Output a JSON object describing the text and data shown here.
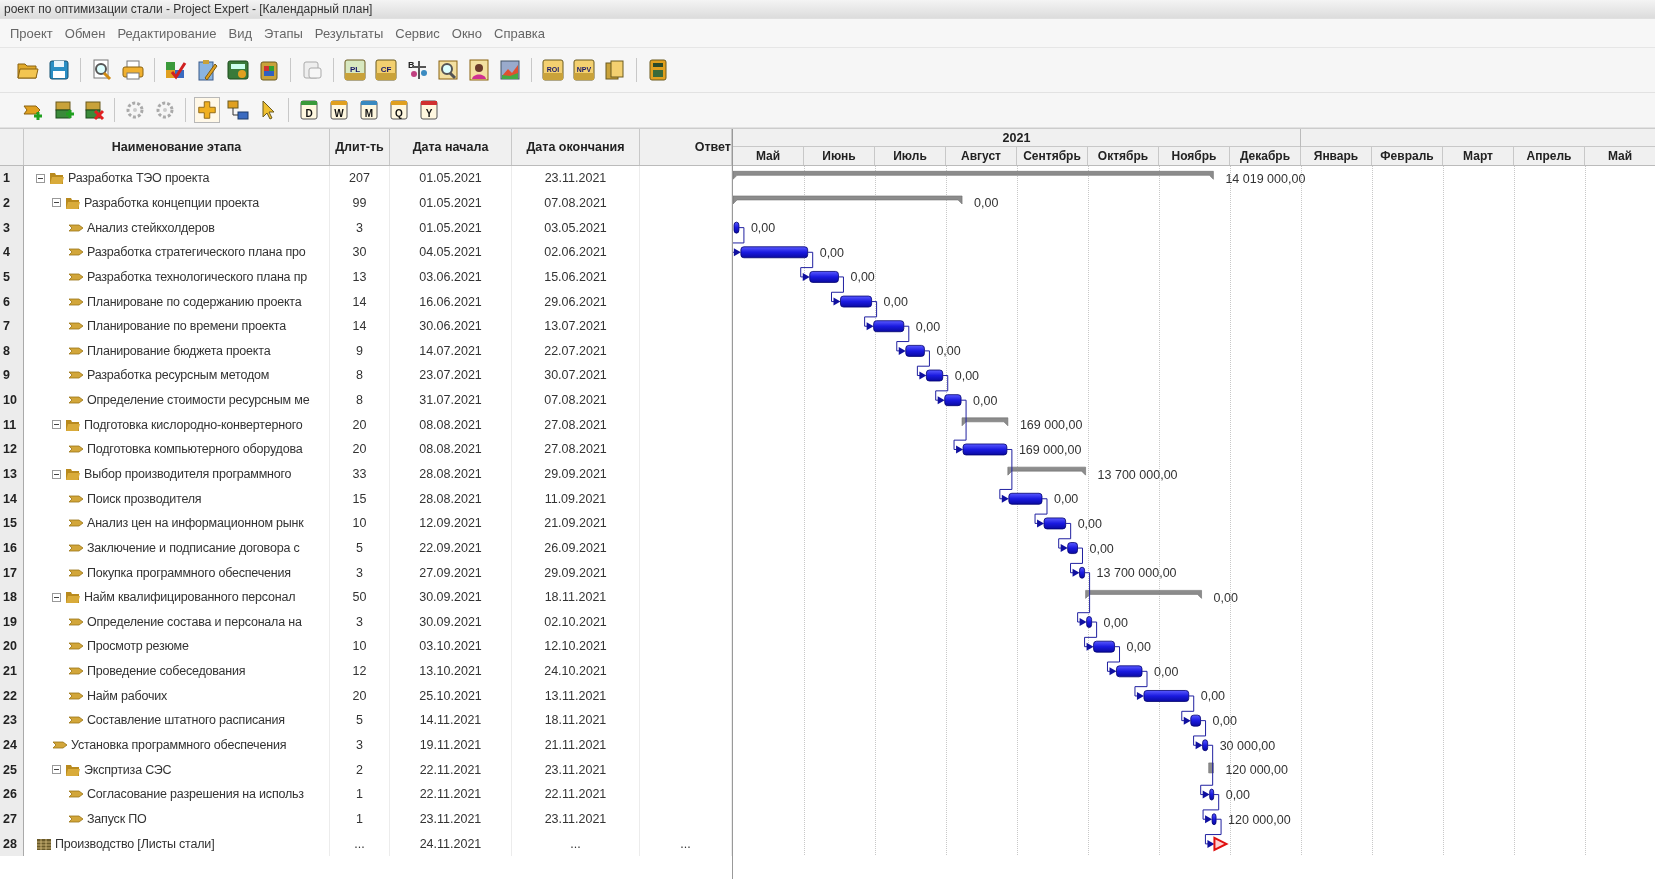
{
  "window": {
    "title": "роект по оптимизации стали - Project Expert  - [Календарный план]"
  },
  "menu": [
    "Проект",
    "Обмен",
    "Редактирование",
    "Вид",
    "Этапы",
    "Результаты",
    "Сервис",
    "Окно",
    "Справка"
  ],
  "toolbar_1": {
    "badges": [
      "PL",
      "CF",
      "B",
      "ROI",
      "NPV"
    ]
  },
  "toolbar_2": {
    "badges": [
      "D",
      "W",
      "M",
      "Q",
      "Y"
    ]
  },
  "table": {
    "columns": [
      "Наименование этапа",
      "Длит-ть",
      "Дата начала",
      "Дата окончания",
      "Ответ"
    ]
  },
  "timeline": {
    "groups": [
      {
        "year": "2021",
        "months": [
          "Май",
          "Июнь",
          "Июль",
          "Август",
          "Сентябрь",
          "Октябрь",
          "Ноябрь",
          "Декабрь"
        ]
      },
      {
        "months": [
          "Январь",
          "Февраль",
          "Март",
          "Апрель",
          "Май"
        ]
      }
    ]
  },
  "rows": [
    {
      "num": "1",
      "kind": "summary",
      "expanded": true,
      "name": "Разработка ТЭО проекта",
      "duration": "207",
      "start": "01.05.2021",
      "end": "23.11.2021",
      "cost": "14 019 000,00",
      "children": [
        {
          "num": "2",
          "kind": "summary",
          "expanded": true,
          "name": "Разработка концепции проекта",
          "duration": "99",
          "start": "01.05.2021",
          "end": "07.08.2021",
          "cost": "0,00",
          "children": [
            {
              "num": "3",
              "kind": "task",
              "name": "Анализ стейкхолдеров",
              "duration": "3",
              "start": "01.05.2021",
              "end": "03.05.2021",
              "cost": "0,00"
            },
            {
              "num": "4",
              "kind": "task",
              "name": "Разработка стратегического плана про",
              "duration": "30",
              "start": "04.05.2021",
              "end": "02.06.2021",
              "cost": "0,00"
            },
            {
              "num": "5",
              "kind": "task",
              "name": "Разработка технологического плана пр",
              "duration": "13",
              "start": "03.06.2021",
              "end": "15.06.2021",
              "cost": "0,00"
            },
            {
              "num": "6",
              "kind": "task",
              "name": "Планироване по содержанию проекта",
              "duration": "14",
              "start": "16.06.2021",
              "end": "29.06.2021",
              "cost": "0,00"
            },
            {
              "num": "7",
              "kind": "task",
              "name": "Планирование по времени проекта",
              "duration": "14",
              "start": "30.06.2021",
              "end": "13.07.2021",
              "cost": "0,00"
            },
            {
              "num": "8",
              "kind": "task",
              "name": "Планирование бюджета проекта",
              "duration": "9",
              "start": "14.07.2021",
              "end": "22.07.2021",
              "cost": "0,00"
            },
            {
              "num": "9",
              "kind": "task",
              "name": "Разработка ресурсным методом",
              "duration": "8",
              "start": "23.07.2021",
              "end": "30.07.2021",
              "cost": "0,00"
            },
            {
              "num": "10",
              "kind": "task",
              "name": "Определение стоимости ресурсным ме",
              "duration": "8",
              "start": "31.07.2021",
              "end": "07.08.2021",
              "cost": "0,00"
            }
          ]
        },
        {
          "num": "11",
          "kind": "summary",
          "expanded": true,
          "name": "Подготовка кислородно-конвертерного",
          "duration": "20",
          "start": "08.08.2021",
          "end": "27.08.2021",
          "cost": "169 000,00",
          "children": [
            {
              "num": "12",
              "kind": "task",
              "name": "Подготовка компьютерного оборудова",
              "duration": "20",
              "start": "08.08.2021",
              "end": "27.08.2021",
              "cost": "169 000,00"
            }
          ]
        },
        {
          "num": "13",
          "kind": "summary",
          "expanded": true,
          "name": "Выбор производителя программного",
          "duration": "33",
          "start": "28.08.2021",
          "end": "29.09.2021",
          "cost": "13 700 000,00",
          "children": [
            {
              "num": "14",
              "kind": "task",
              "name": "Поиск прозводителя",
              "duration": "15",
              "start": "28.08.2021",
              "end": "11.09.2021",
              "cost": "0,00"
            },
            {
              "num": "15",
              "kind": "task",
              "name": "Анализ цен на информационном рынк",
              "duration": "10",
              "start": "12.09.2021",
              "end": "21.09.2021",
              "cost": "0,00"
            },
            {
              "num": "16",
              "kind": "task",
              "name": "Заключение и подписание договора с",
              "duration": "5",
              "start": "22.09.2021",
              "end": "26.09.2021",
              "cost": "0,00"
            },
            {
              "num": "17",
              "kind": "task",
              "name": "Покупка программного обеспечения",
              "duration": "3",
              "start": "27.09.2021",
              "end": "29.09.2021",
              "cost": "13 700 000,00"
            }
          ]
        },
        {
          "num": "18",
          "kind": "summary",
          "expanded": true,
          "name": "Найм квалифицированного персонал",
          "duration": "50",
          "start": "30.09.2021",
          "end": "18.11.2021",
          "cost": "0,00",
          "children": [
            {
              "num": "19",
              "kind": "task",
              "name": "Определение состава и персонала на",
              "duration": "3",
              "start": "30.09.2021",
              "end": "02.10.2021",
              "cost": "0,00"
            },
            {
              "num": "20",
              "kind": "task",
              "name": "Просмотр резюме",
              "duration": "10",
              "start": "03.10.2021",
              "end": "12.10.2021",
              "cost": "0,00"
            },
            {
              "num": "21",
              "kind": "task",
              "name": "Проведение собеседования",
              "duration": "12",
              "start": "13.10.2021",
              "end": "24.10.2021",
              "cost": "0,00"
            },
            {
              "num": "22",
              "kind": "task",
              "name": "Найм рабочих",
              "duration": "20",
              "start": "25.10.2021",
              "end": "13.11.2021",
              "cost": "0,00"
            },
            {
              "num": "23",
              "kind": "task",
              "name": "Составление штатного расписания",
              "duration": "5",
              "start": "14.11.2021",
              "end": "18.11.2021",
              "cost": "0,00"
            }
          ]
        },
        {
          "num": "24",
          "kind": "task",
          "name": "Установка программного обеспечения",
          "duration": "3",
          "start": "19.11.2021",
          "end": "21.11.2021",
          "cost": "30 000,00"
        },
        {
          "num": "25",
          "kind": "summary",
          "expanded": true,
          "name": "Экспртиза СЭС",
          "duration": "2",
          "start": "22.11.2021",
          "end": "23.11.2021",
          "cost": "120 000,00",
          "children": [
            {
              "num": "26",
              "kind": "task",
              "name": "Согласование разрешения на использ",
              "duration": "1",
              "start": "22.11.2021",
              "end": "22.11.2021",
              "cost": "0,00"
            },
            {
              "num": "27",
              "kind": "task",
              "name": "Запуск ПО",
              "duration": "1",
              "start": "23.11.2021",
              "end": "23.11.2021",
              "cost": "120 000,00"
            }
          ]
        }
      ]
    },
    {
      "num": "28",
      "kind": "milestone",
      "name": "Производство [Листы стали]",
      "duration": "...",
      "start": "24.11.2021",
      "end": "...",
      "column_5": "..."
    }
  ]
}
